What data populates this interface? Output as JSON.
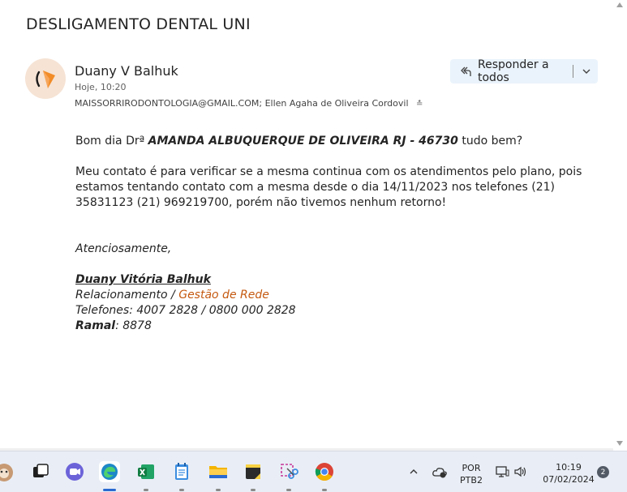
{
  "email": {
    "subject": "DESLIGAMENTO DENTAL UNI",
    "sender": "Duany V Balhuk",
    "time": "Hoje, 10:20",
    "recipients": "MAISSORRIRODONTOLOGIA@GMAIL.COM;  Ellen Agaha de Oliveira Cordovil",
    "reply_all_label": "Responder a todos"
  },
  "body": {
    "greeting_prefix": "Bom dia Drª ",
    "greeting_name": "AMANDA ALBUQUERQUE DE OLIVEIRA RJ - 46730",
    "greeting_suffix": " tudo bem?",
    "paragraph": "Meu contato é para verificar se a mesma continua com os atendimentos pelo plano, pois estamos tentando contato com a mesma desde o dia 14/11/2023 nos telefones (21) 35831123 (21) 969219700, porém não tivemos nenhum retorno!",
    "closing": "Atenciosamente,",
    "sig_name": "Duany Vitória Balhuk ",
    "sig_role_prefix": "Relacionamento / ",
    "sig_role_dept": "Gestão de Rede",
    "sig_phones": "Telefones: 4007 2828 / 0800 000 2828",
    "sig_ramal_label": "Ramal",
    "sig_ramal_value": ": 8878"
  },
  "taskbar": {
    "apps": [
      "cat-app-icon",
      "task-view-icon",
      "teams-icon",
      "edge-icon",
      "excel-icon",
      "notepad-icon",
      "file-explorer-icon",
      "sticky-notes-icon",
      "snipping-tool-icon",
      "chrome-icon"
    ],
    "lang_top": "POR",
    "lang_bottom": "PTB2",
    "clock_time": "10:19",
    "clock_date": "07/02/2024",
    "notification_count": "2"
  },
  "colors": {
    "accent": "#2a6ad1",
    "signature_orange": "#c55a11",
    "reply_button_bg": "#eaf3fb"
  }
}
